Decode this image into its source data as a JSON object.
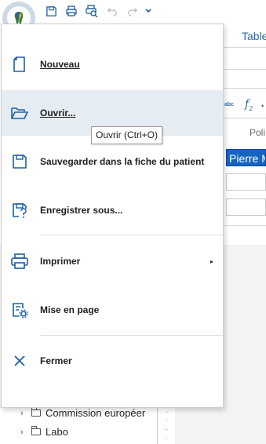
{
  "qat": {
    "buttons": [
      {
        "icon": "save-icon"
      },
      {
        "icon": "print-icon"
      },
      {
        "icon": "print-preview-icon"
      },
      {
        "icon": "undo-icon"
      },
      {
        "icon": "redo-icon"
      },
      {
        "icon": "customize-chevron-icon"
      }
    ]
  },
  "background": {
    "tab_label": "Table",
    "style_label": "Poli",
    "selected_field": "Pierre M",
    "tree": [
      {
        "label": "Commission européer"
      },
      {
        "label": "Labo"
      }
    ]
  },
  "menu": {
    "items": [
      {
        "label": "Nouveau",
        "icon": "new-document-icon"
      },
      {
        "label": "Ouvrir...",
        "icon": "open-folder-icon",
        "hovered": true
      },
      {
        "label": "Sauvegarder dans la fiche du patient",
        "icon": "save-icon"
      },
      {
        "label": "Enregistrer sous...",
        "icon": "save-as-icon"
      },
      {
        "label": "Imprimer",
        "icon": "print-icon",
        "submenu": true
      },
      {
        "label": "Mise en page",
        "icon": "page-setup-icon"
      },
      {
        "label": "Fermer",
        "icon": "close-icon"
      }
    ],
    "tooltip": "Ouvrir (Ctrl+O)"
  },
  "colors": {
    "accent": "#1e5fa3",
    "hover": "#e5ecf2",
    "selection": "#1565c0"
  }
}
